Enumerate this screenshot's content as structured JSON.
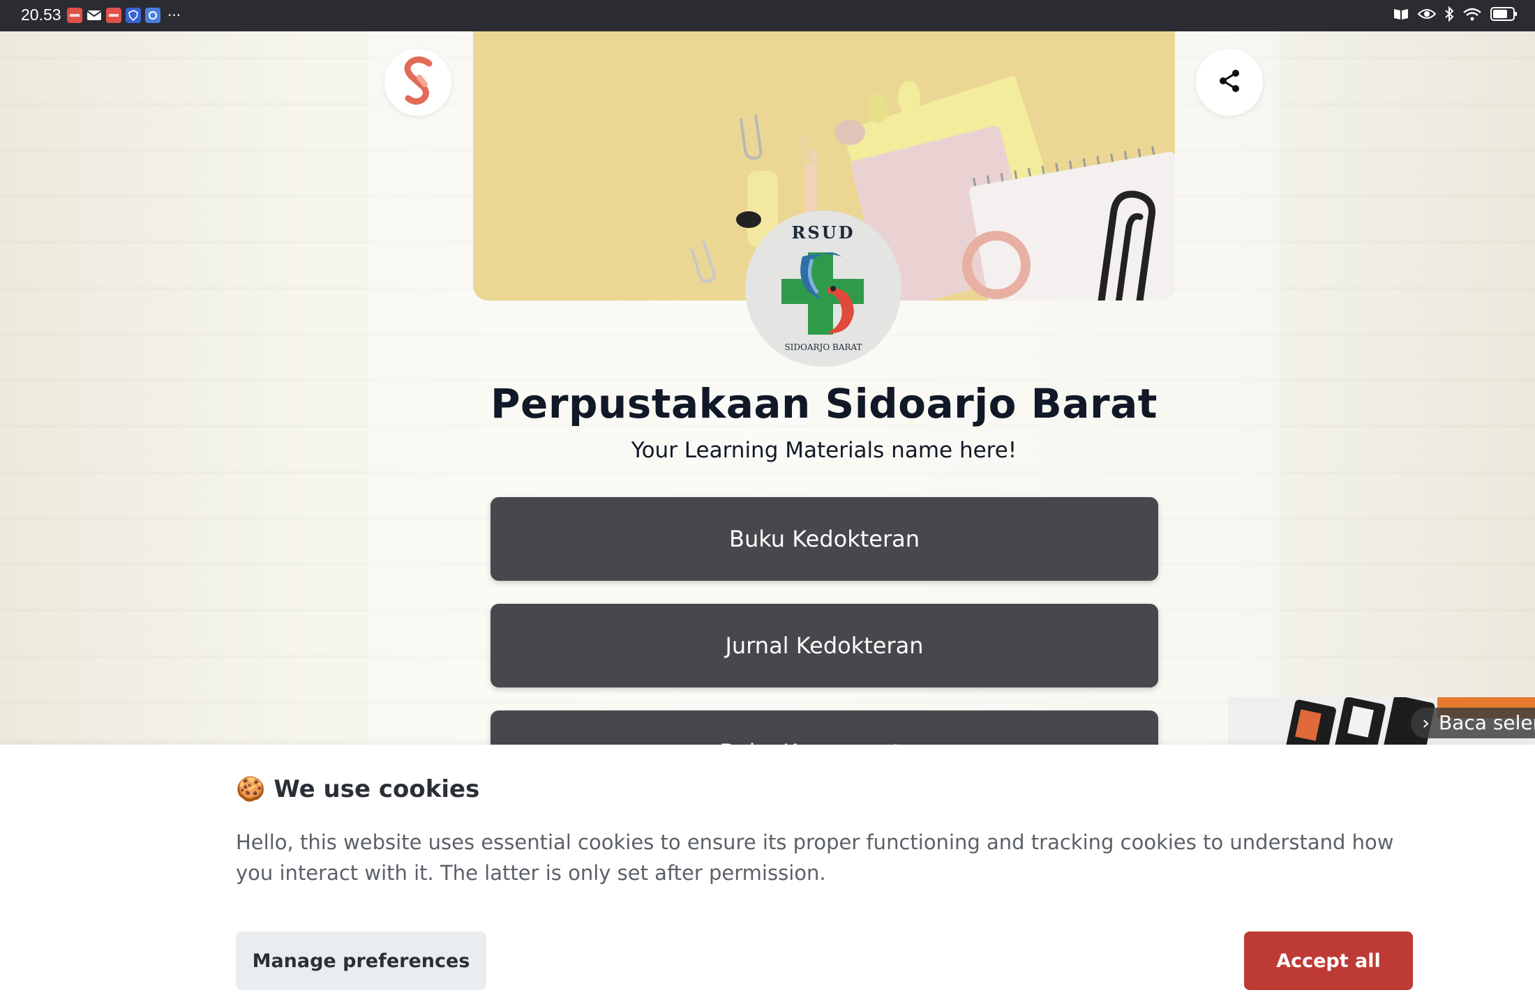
{
  "status_bar": {
    "time": "20.53",
    "more": "···",
    "notification_icons": [
      "app-red-icon",
      "mail-icon",
      "app-red-icon",
      "shield-blue-icon",
      "app-blue-icon"
    ],
    "system_icons": [
      "reader-icon",
      "eye-icon",
      "bluetooth-icon",
      "wifi-icon",
      "battery-icon"
    ]
  },
  "profile": {
    "title": "Perpustakaan Sidoarjo Barat",
    "subtitle": "Your Learning Materials name here!",
    "avatar_top_text": "RSUD",
    "avatar_bottom_text": "SIDOARJO BARAT"
  },
  "links": [
    {
      "label": "Buku Kedokteran"
    },
    {
      "label": "Jurnal Kedokteran"
    },
    {
      "label": "Buku Keperawatan"
    }
  ],
  "ad": {
    "label": "Baca selengkapnya"
  },
  "cookie_banner": {
    "emoji": "🍪",
    "title": "We use cookies",
    "text": "Hello, this website uses essential cookies to ensure its proper functioning and tracking cookies to understand how you interact with it. The latter is only set after permission.",
    "manage_label": "Manage preferences",
    "accept_label": "Accept all"
  },
  "colors": {
    "accent": "#be3a34",
    "link_button": "#48474c",
    "status_bar": "#2b2c31"
  }
}
